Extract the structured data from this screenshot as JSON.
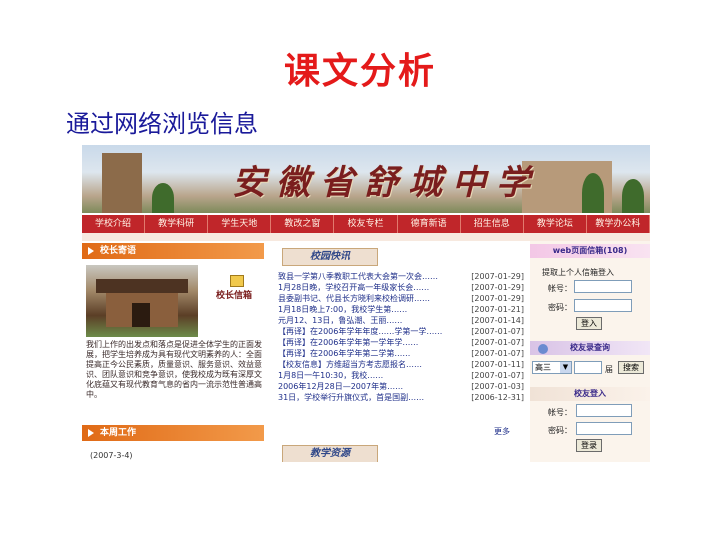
{
  "slide": {
    "title": "课文分析",
    "subtitle": "通过网络浏览信息"
  },
  "banner": {
    "school_name": "安徽省舒城中学"
  },
  "menu": [
    "学校介绍",
    "教学科研",
    "学生天地",
    "教改之窗",
    "校友专栏",
    "德育新语",
    "招生信息",
    "教学论坛",
    "教学办公科"
  ],
  "left": {
    "principal_header": "校长寄语",
    "letter_link": "校长信箱",
    "intro": "我们上作的出发点和落点是促进全体学生的正面发展，把学生培养成为具有现代文明素养的人：全面提高正今公民素质，质量意识、服务意识、效益意识、团队意识和竞争意识，使我校成为既有深厚文化底蕴又有现代教育气息的省内一流示范性普通高中。",
    "week_header": "本周工作",
    "week_date": "(2007-3-4)"
  },
  "middle": {
    "news_header": "校园快讯",
    "news": [
      {
        "title": "致县一学第八季教职工代表大会第一次会……",
        "date": "[2007-01-29]"
      },
      {
        "title": "1月28日晚，学校召开高一年级家长会……",
        "date": "[2007-01-29]"
      },
      {
        "title": "县委副书记、代县长方晓利来校检调研……",
        "date": "[2007-01-29]"
      },
      {
        "title": "1月18日晚上7:00，我校学生第……",
        "date": "[2007-01-21]"
      },
      {
        "title": "元月12、13日，鲁弘潮、王丽……",
        "date": "[2007-01-14]"
      },
      {
        "title": "【再译】在2006年学年年度……学第一学……",
        "date": "[2007-01-07]"
      },
      {
        "title": "【再译】在2006年学年第一学年学……",
        "date": "[2007-01-07]"
      },
      {
        "title": "【再译】在2006年学年第二学第……",
        "date": "[2007-01-07]"
      },
      {
        "title": "【校友信息】方维超当方考志愿报名……",
        "date": "[2007-01-11]"
      },
      {
        "title": "1月8日一午10:30，我校……",
        "date": "[2007-01-07]"
      },
      {
        "title": "2006年12月28日—2007年第……",
        "date": "[2007-01-03]"
      },
      {
        "title": "31日，学校举行升旗仪式，首是国副……",
        "date": "[2006-12-31]"
      }
    ],
    "more": "更多",
    "resource_header": "教学资源"
  },
  "right": {
    "mail_header": "web页面信箱(108)",
    "login_prompt": "提取上个人信箱登入",
    "account_label": "帐号：",
    "password_label": "密码：",
    "login_button": "登入",
    "alumni_search_header": "校友录查询",
    "class_select": "高三",
    "grade_suffix": "届",
    "search_button": "搜索",
    "alumni_login_header": "校友登入",
    "alumni_account_label": "帐号：",
    "alumni_password_label": "密码：",
    "alumni_login_button": "登录"
  }
}
